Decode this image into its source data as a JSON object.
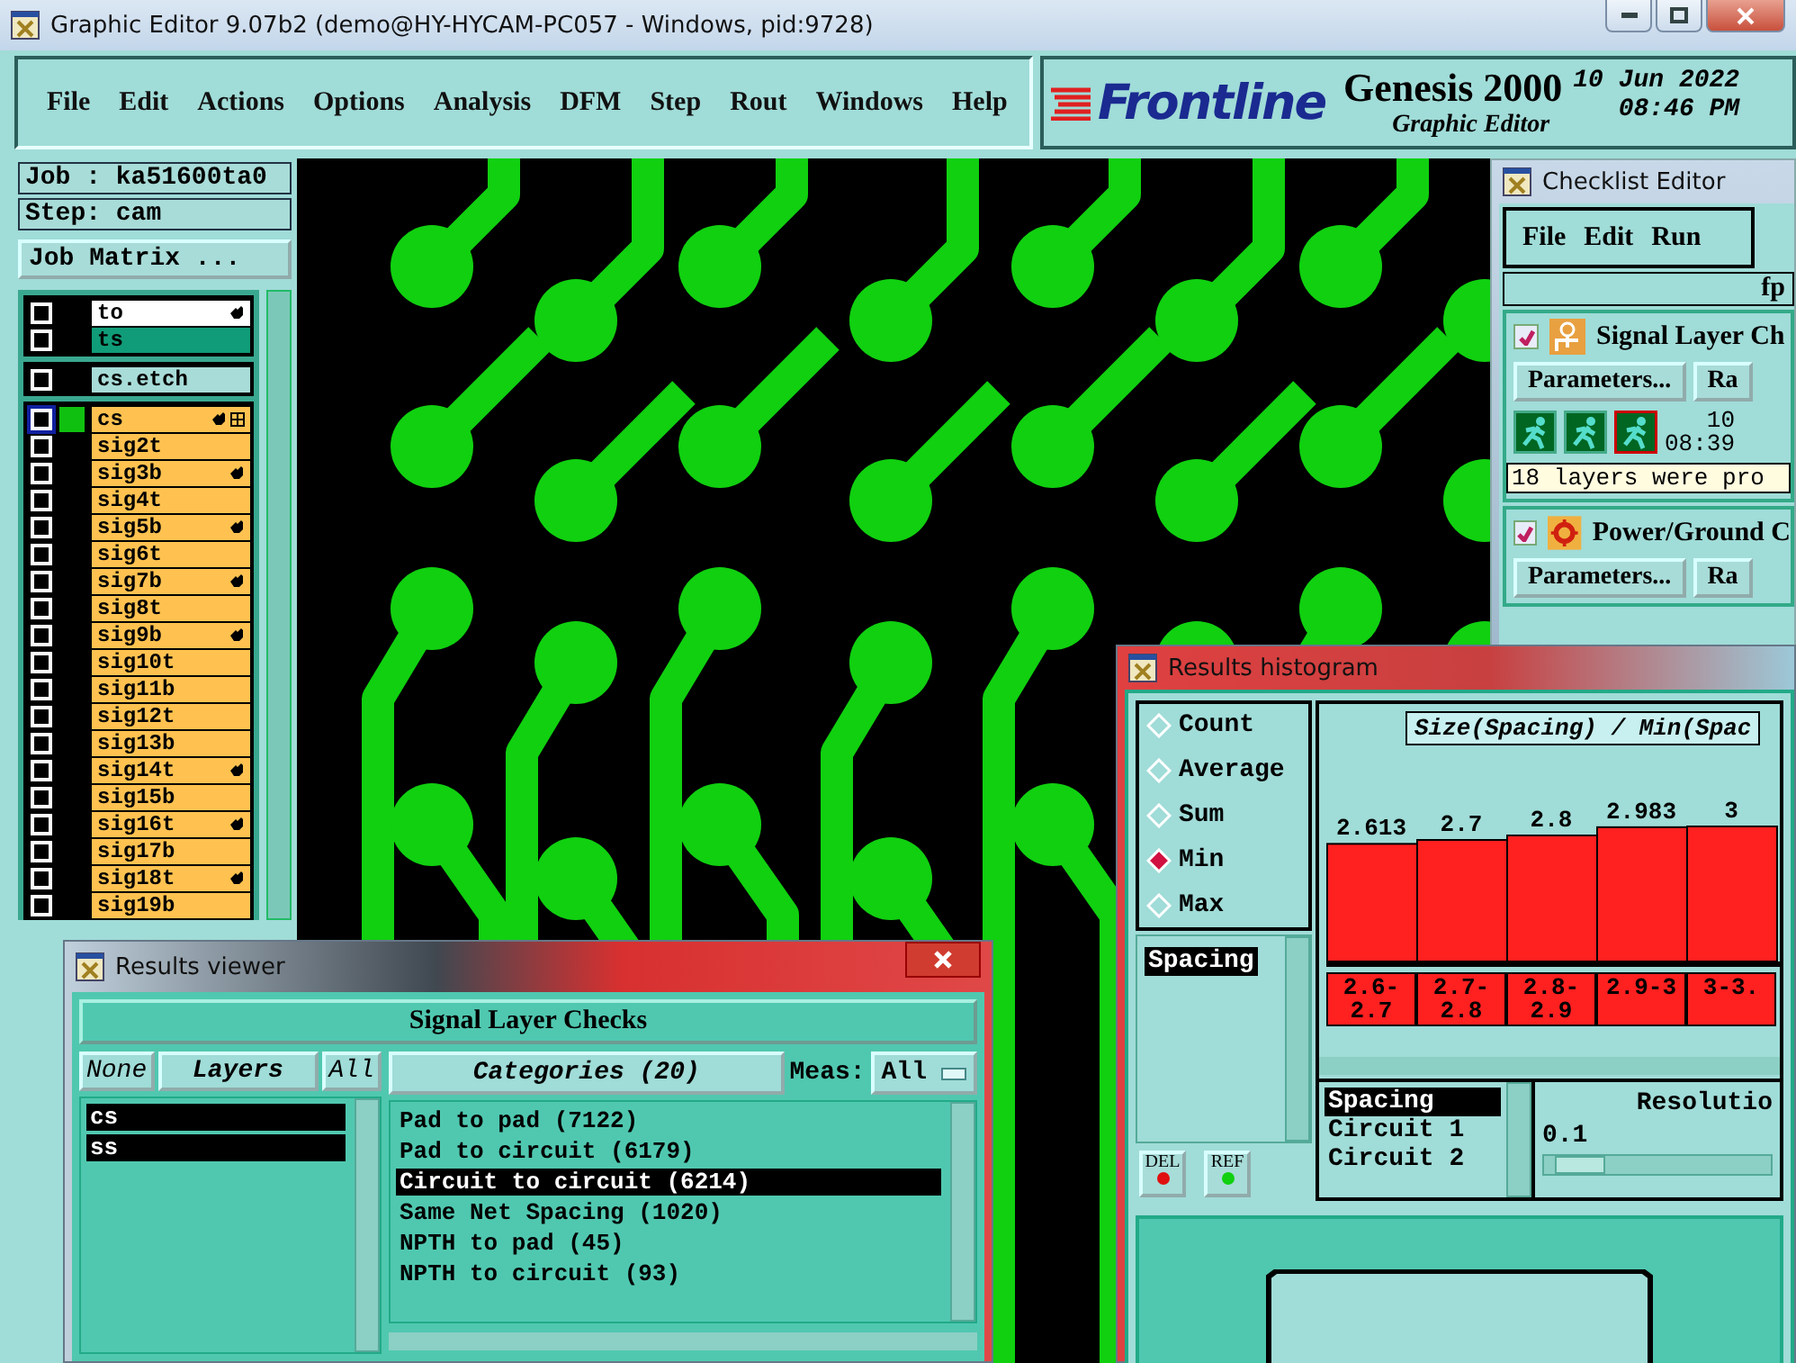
{
  "window": {
    "title": "Graphic Editor 9.07b2 (demo@HY-HYCAM-PC057 - Windows, pid:9728)"
  },
  "menu": [
    "File",
    "Edit",
    "Actions",
    "Options",
    "Analysis",
    "DFM",
    "Step",
    "Rout",
    "Windows",
    "Help"
  ],
  "brand": {
    "logo": "Frontline",
    "product": "Genesis 2000",
    "subtitle": "Graphic Editor",
    "date": "10 Jun 2022",
    "time": "08:46 PM"
  },
  "job": {
    "job": "Job : ka51600ta0",
    "step": "Step: cam",
    "matrix_button": "Job Matrix ..."
  },
  "layer_groups": [
    {
      "layers": [
        {
          "name": "to",
          "kind": "board",
          "selected": false,
          "hand": true,
          "grid": false
        },
        {
          "name": "ts",
          "kind": "mask",
          "selected": false,
          "hand": false,
          "grid": false
        }
      ]
    },
    {
      "layers": [
        {
          "name": "cs.etch",
          "kind": "misc",
          "selected": false,
          "hand": false,
          "grid": false
        }
      ]
    },
    {
      "layers": [
        {
          "name": "cs",
          "kind": "signal",
          "selected": true,
          "hand": true,
          "grid": true
        },
        {
          "name": "sig2t",
          "kind": "signal",
          "selected": false,
          "hand": false,
          "grid": false
        },
        {
          "name": "sig3b",
          "kind": "signal",
          "selected": false,
          "hand": true,
          "grid": false
        },
        {
          "name": "sig4t",
          "kind": "signal",
          "selected": false,
          "hand": false,
          "grid": false
        },
        {
          "name": "sig5b",
          "kind": "signal",
          "selected": false,
          "hand": true,
          "grid": false
        },
        {
          "name": "sig6t",
          "kind": "signal",
          "selected": false,
          "hand": false,
          "grid": false
        },
        {
          "name": "sig7b",
          "kind": "signal",
          "selected": false,
          "hand": true,
          "grid": false
        },
        {
          "name": "sig8t",
          "kind": "signal",
          "selected": false,
          "hand": false,
          "grid": false
        },
        {
          "name": "sig9b",
          "kind": "signal",
          "selected": false,
          "hand": true,
          "grid": false
        },
        {
          "name": "sig10t",
          "kind": "signal",
          "selected": false,
          "hand": false,
          "grid": false
        },
        {
          "name": "sig11b",
          "kind": "signal",
          "selected": false,
          "hand": false,
          "grid": false
        },
        {
          "name": "sig12t",
          "kind": "signal",
          "selected": false,
          "hand": false,
          "grid": false
        },
        {
          "name": "sig13b",
          "kind": "signal",
          "selected": false,
          "hand": false,
          "grid": false
        },
        {
          "name": "sig14t",
          "kind": "signal",
          "selected": false,
          "hand": true,
          "grid": false
        },
        {
          "name": "sig15b",
          "kind": "signal",
          "selected": false,
          "hand": false,
          "grid": false
        },
        {
          "name": "sig16t",
          "kind": "signal",
          "selected": false,
          "hand": true,
          "grid": false
        },
        {
          "name": "sig17b",
          "kind": "signal",
          "selected": false,
          "hand": false,
          "grid": false
        },
        {
          "name": "sig18t",
          "kind": "signal",
          "selected": false,
          "hand": true,
          "grid": false
        },
        {
          "name": "sig19b",
          "kind": "signal",
          "selected": false,
          "hand": false,
          "grid": false
        }
      ]
    }
  ],
  "checklist_editor": {
    "title": "Checklist Editor",
    "menu": [
      "File",
      "Edit",
      "Run"
    ],
    "header": "fp",
    "checks": [
      {
        "kind": "signal",
        "checked": true,
        "title": "Signal Layer Ch",
        "parameters": "Parameters...",
        "run": "Ra",
        "date": "10",
        "time": "08:39",
        "status": "18 layers were pro"
      },
      {
        "kind": "power",
        "checked": true,
        "title": "Power/Ground C",
        "parameters": "Parameters...",
        "run": "Ra"
      }
    ]
  },
  "histogram": {
    "title": "Results histogram",
    "modes": [
      {
        "label": "Count",
        "selected": false
      },
      {
        "label": "Average",
        "selected": false
      },
      {
        "label": "Sum",
        "selected": false
      },
      {
        "label": "Min",
        "selected": true
      },
      {
        "label": "Max",
        "selected": false
      }
    ],
    "measures": [
      {
        "label": "Spacing",
        "selected": true
      }
    ],
    "buttons": [
      "DEL",
      "REF"
    ],
    "chart_title": "Size(Spacing) / Min(Spac",
    "chart_data": {
      "type": "bar",
      "categories": [
        "2.6-2.7",
        "2.7-2.8",
        "2.8-2.9",
        "2.9-3",
        "3-3."
      ],
      "values": [
        2.613,
        2.7,
        2.8,
        2.983,
        3
      ],
      "data_labels": true
    },
    "fields": [
      {
        "label": "Spacing",
        "selected": true
      },
      {
        "label": "Circuit 1",
        "selected": false
      },
      {
        "label": "Circuit 2",
        "selected": false
      }
    ],
    "resolution": {
      "label": "Resolutio",
      "value": "0.1",
      "level": 0.05
    }
  },
  "results_viewer": {
    "title": "Results viewer",
    "header": "Signal Layer Checks",
    "layer_buttons": [
      "None",
      "Layers",
      "All"
    ],
    "layers": [
      {
        "label": "cs",
        "selected": true
      },
      {
        "label": "ss",
        "selected": true
      }
    ],
    "categories_button": "Categories (20)",
    "meas_label": "Meas:",
    "meas_value": "All",
    "categories": [
      {
        "label": "Pad to pad (7122)",
        "selected": false
      },
      {
        "label": "Pad to circuit (6179)",
        "selected": false
      },
      {
        "label": "Circuit to circuit (6214)",
        "selected": true
      },
      {
        "label": "Same Net Spacing (1020)",
        "selected": false
      },
      {
        "label": "NPTH to pad (45)",
        "selected": false
      },
      {
        "label": "NPTH to circuit (93)",
        "selected": false
      }
    ]
  }
}
